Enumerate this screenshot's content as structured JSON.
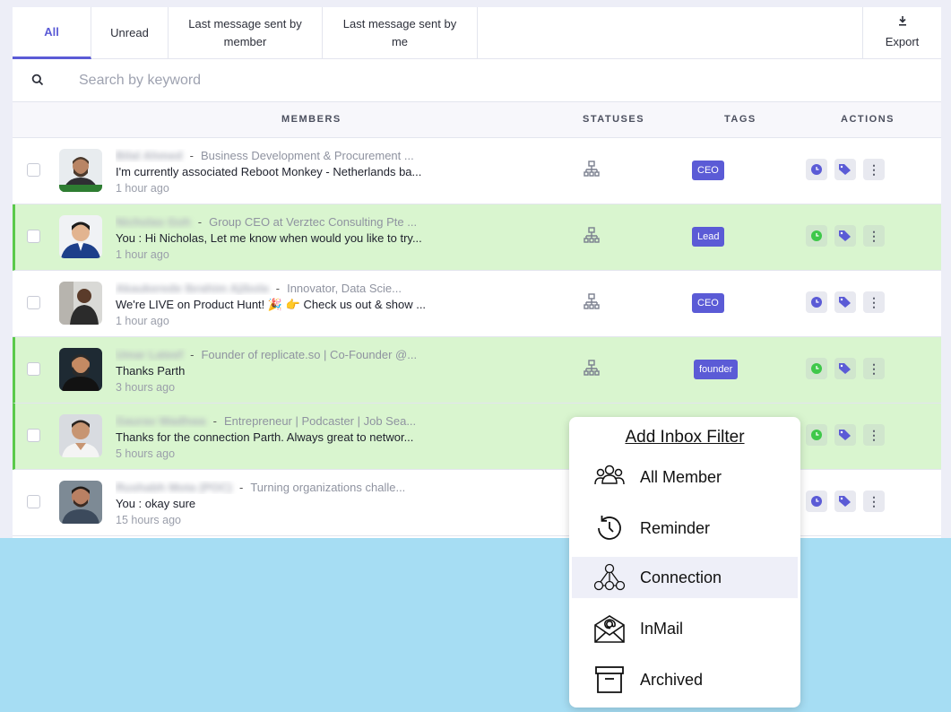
{
  "tabs": {
    "all": "All",
    "unread": "Unread",
    "last_member": "Last message sent by member",
    "last_me": "Last message sent by me",
    "export": "Export"
  },
  "search": {
    "placeholder": "Search by keyword"
  },
  "columns": {
    "members": "MEMBERS",
    "statuses": "STATUSES",
    "tags": "TAGS",
    "actions": "ACTIONS"
  },
  "rows": [
    {
      "name": "Bilal Ahmed",
      "headline": "Business Development & Procurement ...",
      "message": "I'm currently associated Reboot Monkey - Netherlands ba...",
      "time": "1 hour ago",
      "tag": "CEO",
      "highlighted": false,
      "reminder_color": "#5b5bd6"
    },
    {
      "name": "Nicholas Goh",
      "headline": "Group CEO at Verztec Consulting Pte ...",
      "message": "You : Hi Nicholas, Let me know when would you like to try...",
      "time": "1 hour ago",
      "tag": "Lead",
      "highlighted": true,
      "reminder_color": "#3fc84a"
    },
    {
      "name": "Akaukerede Ibrahim Ajibola",
      "headline": "Innovator, Data Scie...",
      "message": "We're LIVE on Product Hunt! 🎉 👉 Check us out & show ...",
      "time": "1 hour ago",
      "tag": "CEO",
      "highlighted": false,
      "reminder_color": "#5b5bd6"
    },
    {
      "name": "Umar Lateef",
      "headline": "Founder of replicate.so | Co-Founder @...",
      "message": "Thanks Parth",
      "time": "3 hours ago",
      "tag": "founder",
      "highlighted": true,
      "reminder_color": "#3fc84a"
    },
    {
      "name": "Gaurav Wadhwa",
      "headline": "Entrepreneur | Podcaster | Job Sea...",
      "message": "Thanks for the connection Parth. Always great to networ...",
      "time": "5 hours ago",
      "tag": "",
      "highlighted": true,
      "reminder_color": "#3fc84a"
    },
    {
      "name": "Rushabh Mota (POC)",
      "headline": "Turning organizations challe...",
      "message": "You : okay sure",
      "time": "15 hours ago",
      "tag": "",
      "highlighted": false,
      "reminder_color": "#5b5bd6"
    }
  ],
  "popup": {
    "title": "Add Inbox Filter",
    "items": [
      {
        "label": "All Member",
        "icon": "group-icon"
      },
      {
        "label": "Reminder",
        "icon": "history-clock-icon"
      },
      {
        "label": "Connection",
        "icon": "network-icon"
      },
      {
        "label": "InMail",
        "icon": "mail-at-icon"
      },
      {
        "label": "Archived",
        "icon": "archive-box-icon"
      }
    ]
  },
  "colors": {
    "accent": "#5b5bd6",
    "row_highlight": "#d9f5cf",
    "highlight_border": "#5ac94a",
    "background_band": "#a6ddf3"
  }
}
